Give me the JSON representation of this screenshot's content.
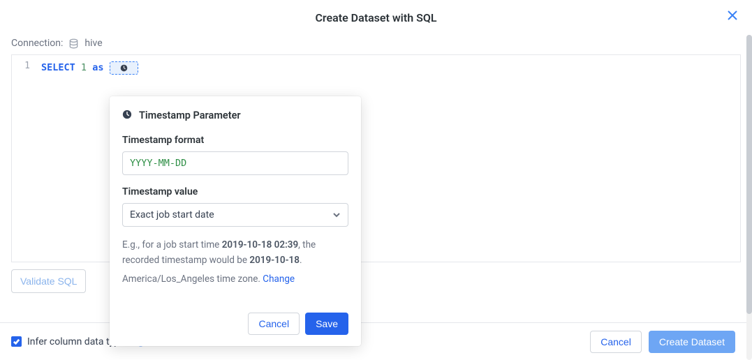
{
  "title": "Create Dataset with SQL",
  "connection": {
    "label": "Connection:",
    "name": "hive"
  },
  "editor": {
    "gutter_line": "1",
    "keyword": "SELECT",
    "literal": "1",
    "as_keyword": "as"
  },
  "popover": {
    "title": "Timestamp Parameter",
    "format_label": "Timestamp format",
    "format_value": "YYYY-MM-DD",
    "value_label": "Timestamp value",
    "value_selected": "Exact job start date",
    "helper_prefix": "E.g., for a job start time ",
    "helper_bold1": "2019-10-18 02:39",
    "helper_mid": ", the recorded timestamp would be ",
    "helper_bold2": "2019-10-18",
    "helper_suffix": ".",
    "tz_text": "America/Los_Angeles time zone. ",
    "change_link": "Change",
    "cancel": "Cancel",
    "save": "Save"
  },
  "validate_label": "Validate SQL",
  "footer": {
    "infer_label": "Infer column data types",
    "cancel": "Cancel",
    "create": "Create Dataset"
  }
}
